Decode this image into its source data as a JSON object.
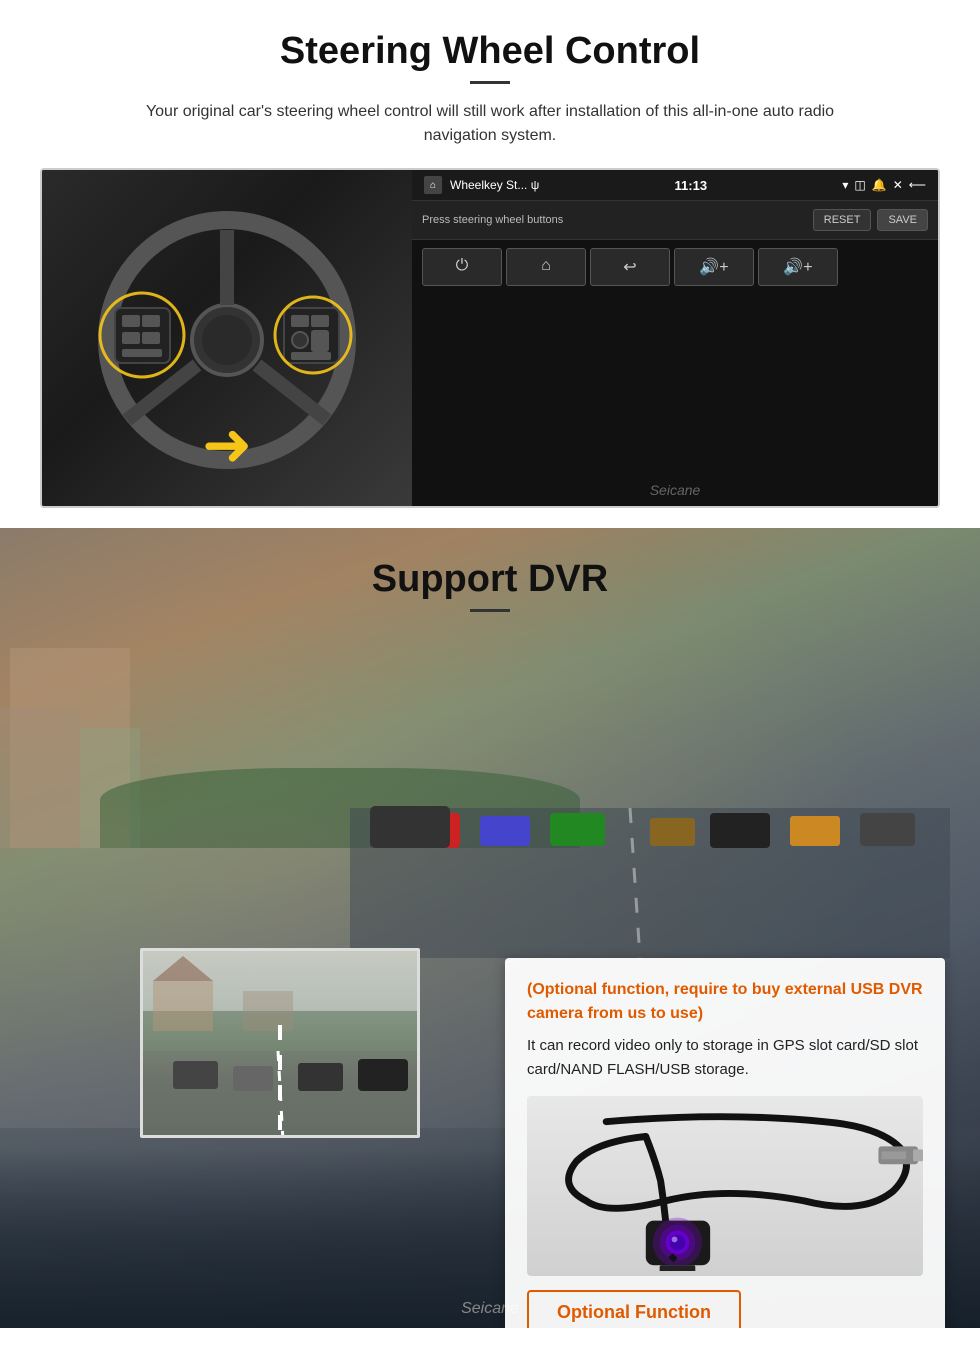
{
  "steering": {
    "title": "Steering Wheel Control",
    "description": "Your original car's steering wheel control will still work after installation of this all-in-one auto radio navigation system.",
    "screen": {
      "app_name": "Wheelkey St... ψ",
      "time": "11:13",
      "prompt": "Press steering wheel buttons",
      "reset_btn": "RESET",
      "save_btn": "SAVE",
      "buttons": [
        "⏻",
        "🏠",
        "↩",
        "🔊+",
        "🔊+"
      ]
    },
    "watermark": "Seicane"
  },
  "dvr": {
    "title": "Support DVR",
    "optional_title": "(Optional function, require to buy external USB DVR camera from us to use)",
    "description": "It can record video only to storage in GPS slot card/SD slot card/NAND FLASH/USB storage.",
    "optional_btn": "Optional Function",
    "watermark": "Seicane",
    "colors": {
      "orange": "#e05a00"
    }
  }
}
